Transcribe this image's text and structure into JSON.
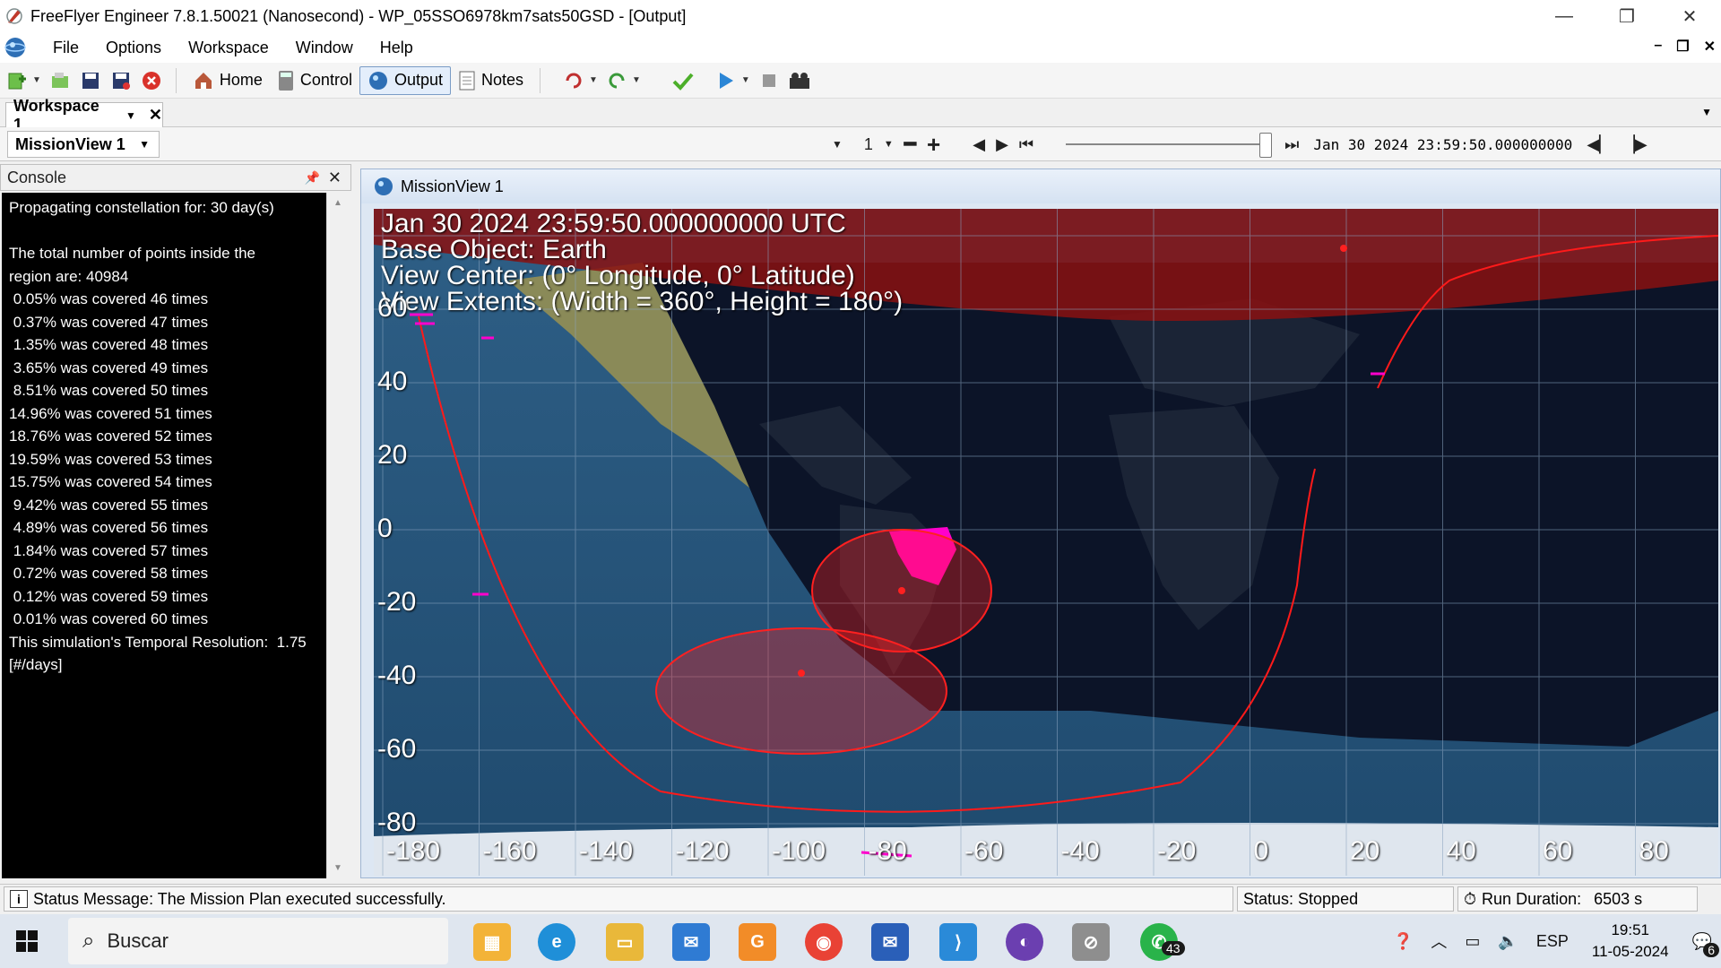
{
  "window": {
    "title": "FreeFlyer Engineer 7.8.1.50021 (Nanosecond) - WP_05SSO6978km7sats50GSD - [Output]",
    "minimize": "—",
    "restore": "❐",
    "close": "✕"
  },
  "menu": {
    "items": [
      "File",
      "Options",
      "Workspace",
      "Window",
      "Help"
    ],
    "mdi_min": "–",
    "mdi_restore": "❐",
    "mdi_close": "✕"
  },
  "toolbar": {
    "home_label": "Home",
    "control_label": "Control",
    "output_label": "Output",
    "notes_label": "Notes"
  },
  "workspace": {
    "tab_label": "Workspace 1",
    "view_select": "MissionView 1"
  },
  "playback": {
    "step": "1",
    "time": "Jan 30 2024 23:59:50.000000000",
    "progress": 1.0
  },
  "console": {
    "title": "Console",
    "lines": [
      "Propagating constellation for: 30 day(s)",
      "",
      "The total number of points inside the",
      "region are: 40984",
      " 0.05% was covered 46 times",
      " 0.37% was covered 47 times",
      " 1.35% was covered 48 times",
      " 3.65% was covered 49 times",
      " 8.51% was covered 50 times",
      "14.96% was covered 51 times",
      "18.76% was covered 52 times",
      "19.59% was covered 53 times",
      "15.75% was covered 54 times",
      " 9.42% was covered 55 times",
      " 4.89% was covered 56 times",
      " 1.84% was covered 57 times",
      " 0.72% was covered 58 times",
      " 0.12% was covered 59 times",
      " 0.01% was covered 60 times",
      "This simulation's Temporal Resolution:  1.75",
      "[#/days]"
    ]
  },
  "mission_view": {
    "title": "MissionView 1",
    "overlay": {
      "epoch": "Jan 30 2024 23:59:50.000000000 UTC",
      "base_object": "Base Object: Earth",
      "view_center": "View Center: (0° Longitude, 0° Latitude)",
      "view_extents": "View Extents: (Width = 360°, Height = 180°)"
    },
    "lat_labels": [
      "60",
      "40",
      "20",
      "0",
      "-20",
      "-40",
      "-60",
      "-80"
    ],
    "lon_labels": [
      "-180",
      "-160",
      "-140",
      "-120",
      "-100",
      "-80",
      "-60",
      "-40",
      "-20",
      "0",
      "20",
      "40",
      "60",
      "80"
    ],
    "colors": {
      "coverage": "#ff2020",
      "target_region": "#ff00cc",
      "ground_track": "#ff1a1a"
    }
  },
  "status": {
    "message": "Status Message: The Mission Plan executed successfully.",
    "state": "Status: Stopped",
    "run_duration_label": "Run Duration:",
    "run_duration_value": "6503 s"
  },
  "taskbar": {
    "search_label": "Buscar",
    "whatsapp_badge": "43",
    "language": "ESP",
    "time": "19:51",
    "date": "11-05-2024",
    "notifications": "6"
  }
}
